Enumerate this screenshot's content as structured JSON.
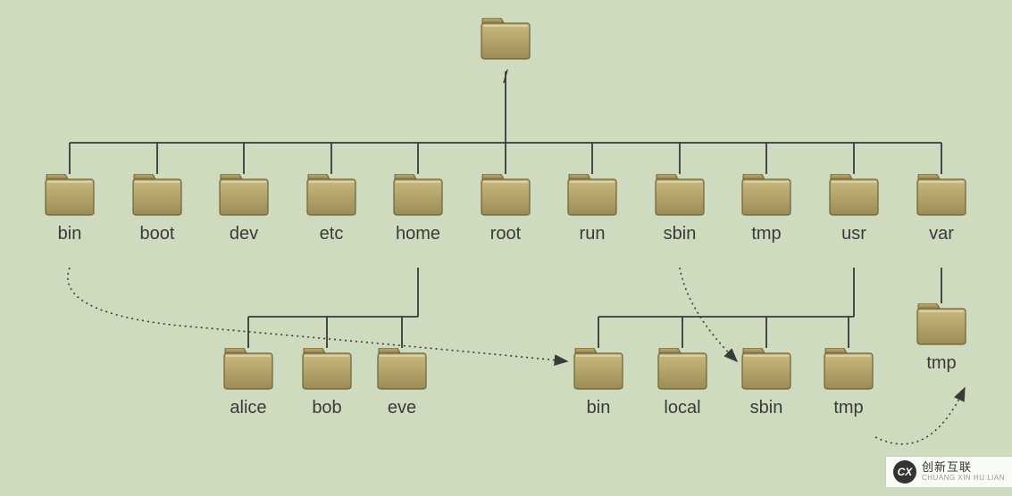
{
  "root": {
    "label": "/",
    "children": [
      {
        "id": "bin",
        "label": "bin"
      },
      {
        "id": "boot",
        "label": "boot"
      },
      {
        "id": "dev",
        "label": "dev"
      },
      {
        "id": "etc",
        "label": "etc"
      },
      {
        "id": "home",
        "label": "home",
        "children": [
          {
            "id": "alice",
            "label": "alice"
          },
          {
            "id": "bob",
            "label": "bob"
          },
          {
            "id": "eve",
            "label": "eve"
          }
        ]
      },
      {
        "id": "root",
        "label": "root"
      },
      {
        "id": "run",
        "label": "run"
      },
      {
        "id": "sbin",
        "label": "sbin"
      },
      {
        "id": "tmp",
        "label": "tmp"
      },
      {
        "id": "usr",
        "label": "usr",
        "children": [
          {
            "id": "usr-bin",
            "label": "bin"
          },
          {
            "id": "usr-local",
            "label": "local"
          },
          {
            "id": "usr-sbin",
            "label": "sbin"
          },
          {
            "id": "usr-tmp",
            "label": "tmp"
          }
        ]
      },
      {
        "id": "var",
        "label": "var",
        "children": [
          {
            "id": "var-tmp",
            "label": "tmp"
          }
        ]
      }
    ]
  },
  "dotted_links": [
    {
      "from": "bin",
      "to": "usr-bin"
    },
    {
      "from": "sbin",
      "to": "usr-sbin"
    },
    {
      "from": "usr-tmp",
      "to": "var-tmp"
    }
  ],
  "watermark": {
    "logo_text": "CX",
    "main": "创新互联",
    "sub": "CHUANG XIN HU LIAN"
  }
}
